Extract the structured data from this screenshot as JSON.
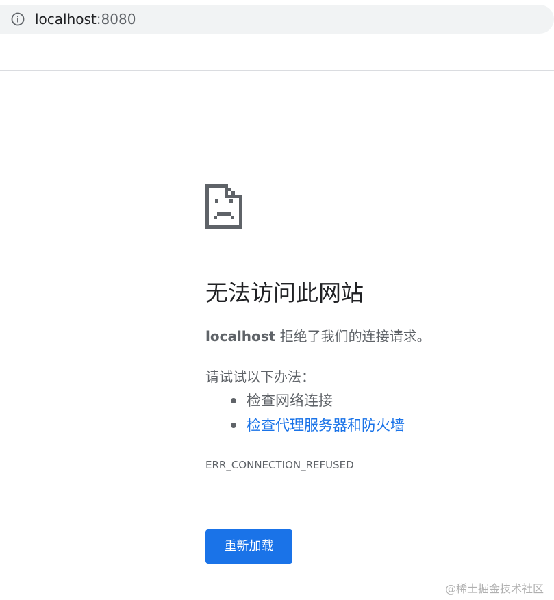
{
  "address_bar": {
    "icon": "info-icon",
    "host": "localhost",
    "port": ":8080"
  },
  "error": {
    "icon": "sad-page-icon",
    "title": "无法访问此网站",
    "summary_host": "localhost",
    "summary_text": " 拒绝了我们的连接请求。",
    "suggestions_heading": "请试试以下办法：",
    "suggestions": [
      {
        "label": "检查网络连接",
        "is_link": false
      },
      {
        "label": "检查代理服务器和防火墙",
        "is_link": true
      }
    ],
    "code": "ERR_CONNECTION_REFUSED",
    "reload_label": "重新加载"
  },
  "watermark": "@稀土掘金技术社区",
  "colors": {
    "link": "#1a73e8",
    "button": "#1a73e8",
    "text_primary": "#202124",
    "text_secondary": "#5f6368",
    "omnibox_bg": "#f1f3f4"
  }
}
